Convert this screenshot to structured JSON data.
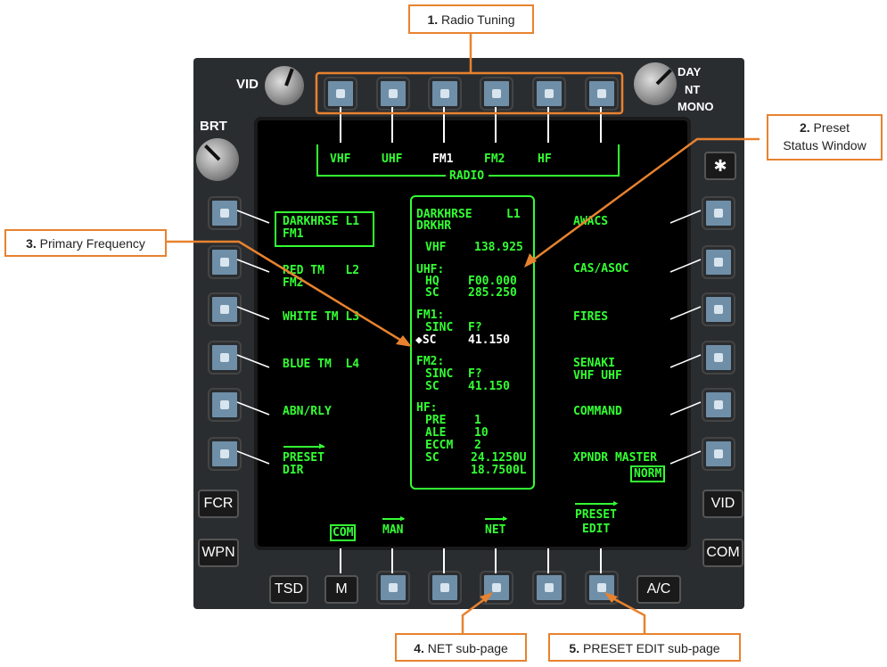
{
  "knobs": {
    "vid": "VID",
    "brt": "BRT",
    "day": "DAY",
    "nt": "NT",
    "mono": "MONO"
  },
  "star": "✱",
  "left_fixed": [
    "FCR",
    "WPN"
  ],
  "right_fixed": [
    "VID",
    "COM"
  ],
  "bottom_fixed": [
    "TSD",
    "M",
    "A/C"
  ],
  "top_tabs": [
    "VHF",
    "UHF",
    "FM1",
    "FM2",
    "HF"
  ],
  "radio_label": "RADIO",
  "left_items": [
    {
      "l1": "DARKHRSE L1",
      "l2": "FM1"
    },
    {
      "l1": "RED TM   L2",
      "l2": "FM2"
    },
    {
      "l1": "WHITE TM L3",
      "l2": ""
    },
    {
      "l1": "BLUE TM  L4",
      "l2": ""
    },
    {
      "l1": "ABN/RLY",
      "l2": ""
    },
    {
      "l1": "PRESET",
      "l2": "DIR"
    }
  ],
  "right_items": [
    {
      "l1": "AWACS",
      "l2": ""
    },
    {
      "l1": "CAS/ASOC",
      "l2": ""
    },
    {
      "l1": "FIRES",
      "l2": ""
    },
    {
      "l1": "SENAKI",
      "l2": "VHF UHF"
    },
    {
      "l1": "COMMAND",
      "l2": ""
    },
    {
      "l1": "XPNDR MASTER",
      "l2": "NORM"
    }
  ],
  "status": {
    "name": "DARKHRSE",
    "slot": "L1",
    "short": "DRKHR",
    "vhf_label": "VHF",
    "vhf_freq": "138.925",
    "uhf_label": "UHF:",
    "uhf_hq_label": "HQ",
    "uhf_hq": "F00.000",
    "uhf_sc_label": "SC",
    "uhf_sc": "285.250",
    "fm1_label": "FM1:",
    "fm1_sinc_label": "SINC",
    "fm1_sinc": "F?",
    "fm1_sc_label": "◆SC",
    "fm1_sc": "41.150",
    "fm2_label": "FM2:",
    "fm2_sinc_label": "SINC",
    "fm2_sinc": "F?",
    "fm2_sc_label": "SC",
    "fm2_sc": "41.150",
    "hf_label": "HF:",
    "hf_pre_label": "PRE",
    "hf_pre": "1",
    "hf_ale_label": "ALE",
    "hf_ale": "10",
    "hf_eccm_label": "ECCM",
    "hf_eccm": "2",
    "hf_sc_label": "SC",
    "hf_sc1": "24.1250U",
    "hf_sc2": "18.7500L"
  },
  "bottom_tabs": {
    "com": "COM",
    "man": "MAN",
    "net": "NET",
    "preset": "PRESET",
    "edit": "EDIT"
  },
  "callouts": {
    "c1_num": "1.",
    "c1_text": "Radio Tuning",
    "c2_num": "2.",
    "c2_text1": "Preset",
    "c2_text2": "Status Window",
    "c3_num": "3.",
    "c3_text": "Primary Frequency",
    "c4_num": "4.",
    "c4_text": "NET sub-page",
    "c5_num": "5.",
    "c5_text": "PRESET EDIT sub-page"
  },
  "colors": {
    "symbology": "#33ff33",
    "callout": "#e8822e",
    "bezel": "#2a2d30"
  }
}
